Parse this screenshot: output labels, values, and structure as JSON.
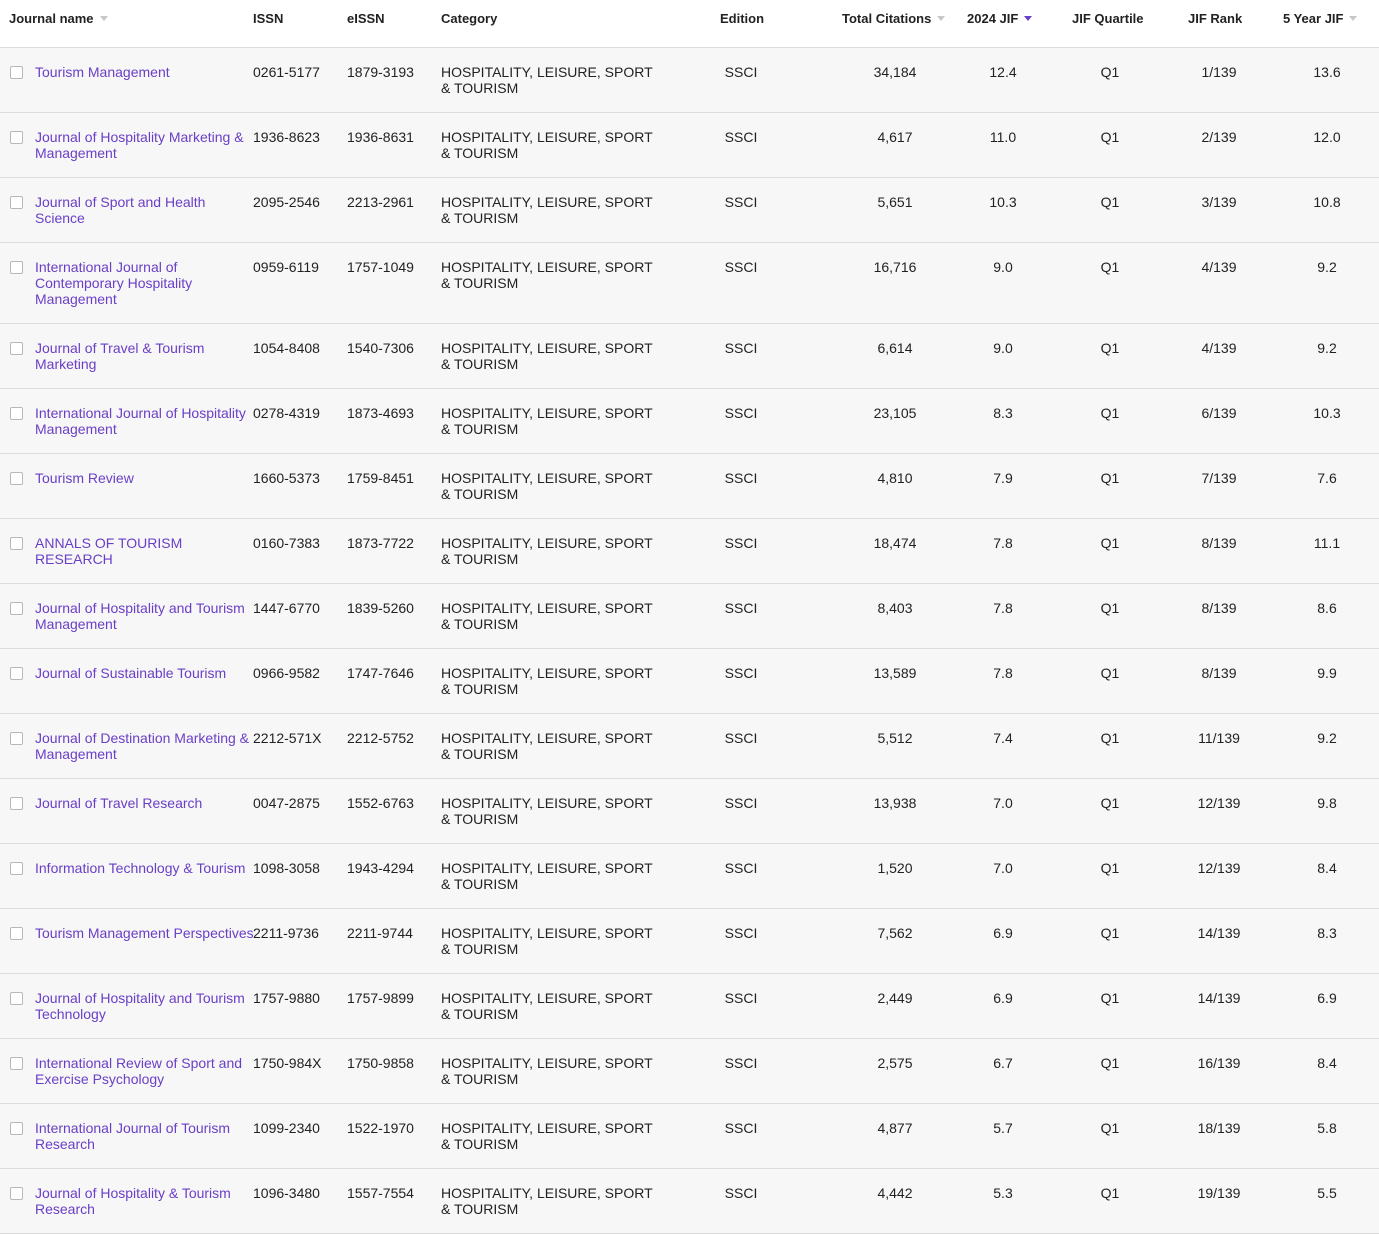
{
  "columns": {
    "journal_name": "Journal name",
    "issn": "ISSN",
    "eissn": "eISSN",
    "category": "Category",
    "edition": "Edition",
    "total_citations": "Total Citations",
    "jif": "2024 JIF",
    "quartile": "JIF Quartile",
    "rank": "JIF Rank",
    "five_year": "5 Year JIF"
  },
  "sort": {
    "active_column": "2024 JIF",
    "direction": "descending",
    "accent_color": "#6a3fc7"
  },
  "rows": [
    {
      "name": "Tourism Management",
      "issn": "0261-5177",
      "eissn": "1879-3193",
      "category": "HOSPITALITY, LEISURE, SPORT & TOURISM",
      "edition": "SSCI",
      "citations": "34,184",
      "jif": "12.4",
      "quartile": "Q1",
      "rank": "1/139",
      "five_year": "13.6"
    },
    {
      "name": "Journal of Hospitality Marketing & Management",
      "issn": "1936-8623",
      "eissn": "1936-8631",
      "category": "HOSPITALITY, LEISURE, SPORT & TOURISM",
      "edition": "SSCI",
      "citations": "4,617",
      "jif": "11.0",
      "quartile": "Q1",
      "rank": "2/139",
      "five_year": "12.0"
    },
    {
      "name": "Journal of Sport and Health Science",
      "issn": "2095-2546",
      "eissn": "2213-2961",
      "category": "HOSPITALITY, LEISURE, SPORT & TOURISM",
      "edition": "SSCI",
      "citations": "5,651",
      "jif": "10.3",
      "quartile": "Q1",
      "rank": "3/139",
      "five_year": "10.8"
    },
    {
      "name": "International Journal of Contemporary Hospitality Management",
      "issn": "0959-6119",
      "eissn": "1757-1049",
      "category": "HOSPITALITY, LEISURE, SPORT & TOURISM",
      "edition": "SSCI",
      "citations": "16,716",
      "jif": "9.0",
      "quartile": "Q1",
      "rank": "4/139",
      "five_year": "9.2"
    },
    {
      "name": "Journal of Travel & Tourism Marketing",
      "issn": "1054-8408",
      "eissn": "1540-7306",
      "category": "HOSPITALITY, LEISURE, SPORT & TOURISM",
      "edition": "SSCI",
      "citations": "6,614",
      "jif": "9.0",
      "quartile": "Q1",
      "rank": "4/139",
      "five_year": "9.2"
    },
    {
      "name": "International Journal of Hospitality Management",
      "issn": "0278-4319",
      "eissn": "1873-4693",
      "category": "HOSPITALITY, LEISURE, SPORT & TOURISM",
      "edition": "SSCI",
      "citations": "23,105",
      "jif": "8.3",
      "quartile": "Q1",
      "rank": "6/139",
      "five_year": "10.3"
    },
    {
      "name": "Tourism Review",
      "issn": "1660-5373",
      "eissn": "1759-8451",
      "category": "HOSPITALITY, LEISURE, SPORT & TOURISM",
      "edition": "SSCI",
      "citations": "4,810",
      "jif": "7.9",
      "quartile": "Q1",
      "rank": "7/139",
      "five_year": "7.6"
    },
    {
      "name": "ANNALS OF TOURISM RESEARCH",
      "issn": "0160-7383",
      "eissn": "1873-7722",
      "category": "HOSPITALITY, LEISURE, SPORT & TOURISM",
      "edition": "SSCI",
      "citations": "18,474",
      "jif": "7.8",
      "quartile": "Q1",
      "rank": "8/139",
      "five_year": "11.1"
    },
    {
      "name": "Journal of Hospitality and Tourism Management",
      "issn": "1447-6770",
      "eissn": "1839-5260",
      "category": "HOSPITALITY, LEISURE, SPORT & TOURISM",
      "edition": "SSCI",
      "citations": "8,403",
      "jif": "7.8",
      "quartile": "Q1",
      "rank": "8/139",
      "five_year": "8.6"
    },
    {
      "name": "Journal of Sustainable Tourism",
      "issn": "0966-9582",
      "eissn": "1747-7646",
      "category": "HOSPITALITY, LEISURE, SPORT & TOURISM",
      "edition": "SSCI",
      "citations": "13,589",
      "jif": "7.8",
      "quartile": "Q1",
      "rank": "8/139",
      "five_year": "9.9"
    },
    {
      "name": "Journal of Destination Marketing & Management",
      "issn": "2212-571X",
      "eissn": "2212-5752",
      "category": "HOSPITALITY, LEISURE, SPORT & TOURISM",
      "edition": "SSCI",
      "citations": "5,512",
      "jif": "7.4",
      "quartile": "Q1",
      "rank": "11/139",
      "five_year": "9.2"
    },
    {
      "name": "Journal of Travel Research",
      "issn": "0047-2875",
      "eissn": "1552-6763",
      "category": "HOSPITALITY, LEISURE, SPORT & TOURISM",
      "edition": "SSCI",
      "citations": "13,938",
      "jif": "7.0",
      "quartile": "Q1",
      "rank": "12/139",
      "five_year": "9.8"
    },
    {
      "name": "Information Technology & Tourism",
      "issn": "1098-3058",
      "eissn": "1943-4294",
      "category": "HOSPITALITY, LEISURE, SPORT & TOURISM",
      "edition": "SSCI",
      "citations": "1,520",
      "jif": "7.0",
      "quartile": "Q1",
      "rank": "12/139",
      "five_year": "8.4"
    },
    {
      "name": "Tourism Management Perspectives",
      "issn": "2211-9736",
      "eissn": "2211-9744",
      "category": "HOSPITALITY, LEISURE, SPORT & TOURISM",
      "edition": "SSCI",
      "citations": "7,562",
      "jif": "6.9",
      "quartile": "Q1",
      "rank": "14/139",
      "five_year": "8.3"
    },
    {
      "name": "Journal of Hospitality and Tourism Technology",
      "issn": "1757-9880",
      "eissn": "1757-9899",
      "category": "HOSPITALITY, LEISURE, SPORT & TOURISM",
      "edition": "SSCI",
      "citations": "2,449",
      "jif": "6.9",
      "quartile": "Q1",
      "rank": "14/139",
      "five_year": "6.9"
    },
    {
      "name": "International Review of Sport and Exercise Psychology",
      "issn": "1750-984X",
      "eissn": "1750-9858",
      "category": "HOSPITALITY, LEISURE, SPORT & TOURISM",
      "edition": "SSCI",
      "citations": "2,575",
      "jif": "6.7",
      "quartile": "Q1",
      "rank": "16/139",
      "five_year": "8.4"
    },
    {
      "name": "International Journal of Tourism Research",
      "issn": "1099-2340",
      "eissn": "1522-1970",
      "category": "HOSPITALITY, LEISURE, SPORT & TOURISM",
      "edition": "SSCI",
      "citations": "4,877",
      "jif": "5.7",
      "quartile": "Q1",
      "rank": "18/139",
      "five_year": "5.8"
    },
    {
      "name": "Journal of Hospitality & Tourism Research",
      "issn": "1096-3480",
      "eissn": "1557-7554",
      "category": "HOSPITALITY, LEISURE, SPORT & TOURISM",
      "edition": "SSCI",
      "citations": "4,442",
      "jif": "5.3",
      "quartile": "Q1",
      "rank": "19/139",
      "five_year": "5.5"
    }
  ]
}
